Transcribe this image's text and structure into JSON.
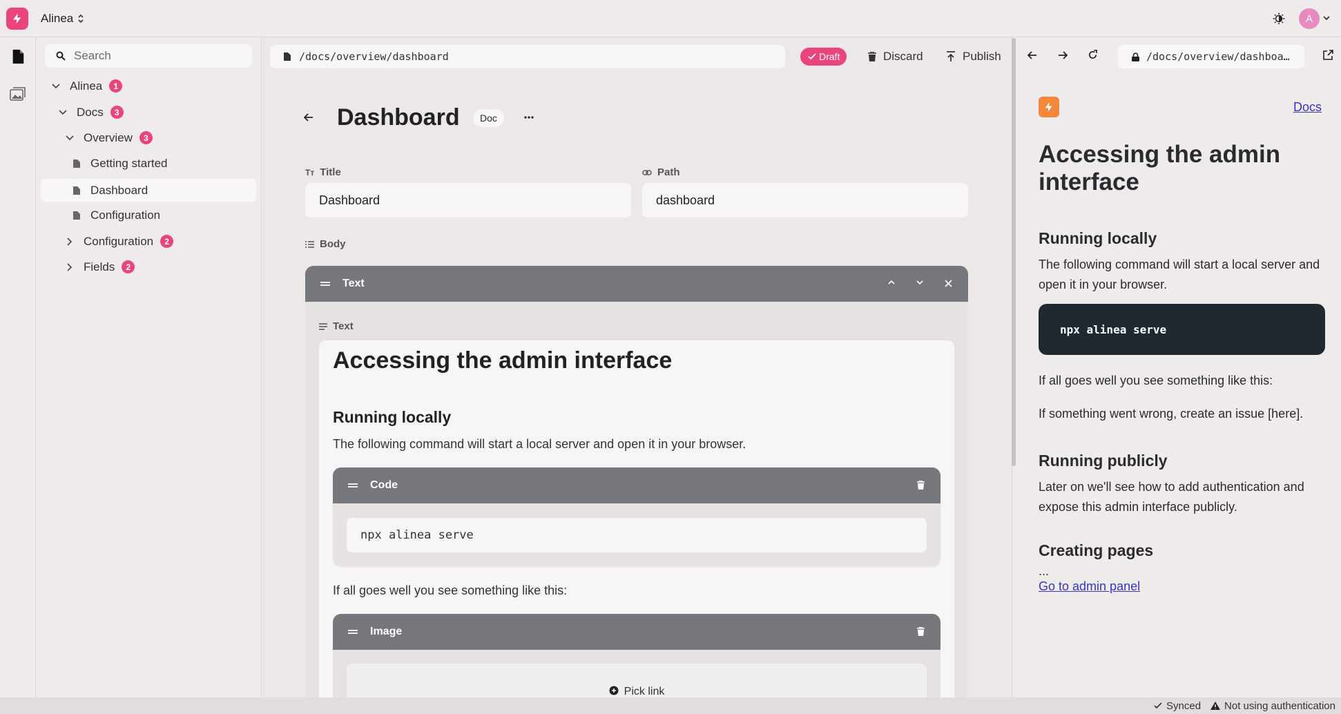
{
  "app": {
    "workspace": "Alinea"
  },
  "user": {
    "avatar_initial": "A"
  },
  "sidebar": {
    "search_placeholder": "Search",
    "tree": [
      {
        "label": "Alinea",
        "badge": "1"
      },
      {
        "label": "Docs",
        "badge": "3"
      },
      {
        "label": "Overview",
        "badge": "3"
      },
      {
        "label": "Getting started"
      },
      {
        "label": "Dashboard"
      },
      {
        "label": "Configuration"
      },
      {
        "label": "Configuration",
        "badge": "2"
      },
      {
        "label": "Fields",
        "badge": "2"
      }
    ]
  },
  "editor": {
    "url": "/docs/overview/dashboard",
    "status_badge": "Draft",
    "discard_label": "Discard",
    "publish_label": "Publish",
    "title": "Dashboard",
    "type_badge": "Doc",
    "fields": {
      "title_label": "Title",
      "title_value": "Dashboard",
      "path_label": "Path",
      "path_value": "dashboard",
      "body_label": "Body"
    },
    "text_block": {
      "header": "Text",
      "field_label": "Text",
      "h1": "Accessing the admin interface",
      "h2": "Running locally",
      "p1": "The following command will start a local server and open it in your browser.",
      "code_block": {
        "header": "Code",
        "value": "npx alinea serve"
      },
      "p2": "If all goes well you see something like this:",
      "image_block": {
        "header": "Image",
        "pick_link": "Pick link"
      }
    }
  },
  "preview": {
    "url": "/docs/overview/dashboa…",
    "nav_link": "Docs",
    "h1": "Accessing the admin interface",
    "h2_running_locally": "Running locally",
    "p_running_locally": "The following command will start a local server and open it in your browser.",
    "code": "npx alinea serve",
    "p_goes_well": "If all goes well you see something like this:",
    "p_went_wrong": "If something went wrong, create an issue [here].",
    "h2_running_publicly": "Running publicly",
    "p_running_publicly": "Later on we'll see how to add authentication and expose this admin interface publicly.",
    "h2_creating_pages": "Creating pages",
    "ellipsis": "...",
    "admin_link": "Go to admin panel"
  },
  "statusbar": {
    "synced": "Synced",
    "auth": "Not using authentication"
  },
  "colors": {
    "accent": "#e9457a",
    "block_header": "#75777d",
    "code_bg": "#202830",
    "preview_logo": "#f4873e"
  }
}
